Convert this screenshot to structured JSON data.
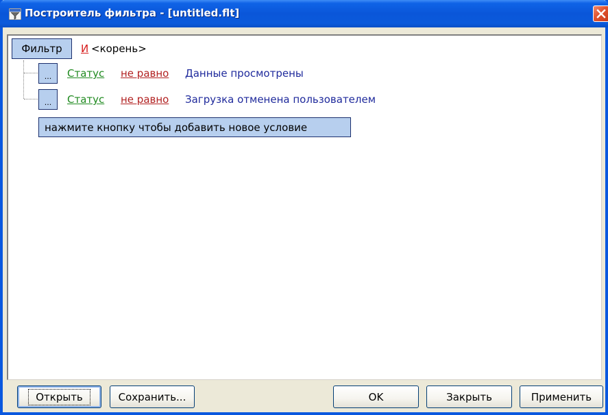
{
  "window": {
    "title": "Построитель фильтра - [untitled.flt]",
    "icon": "filter-funnel-icon",
    "close_icon": "close-icon"
  },
  "filter": {
    "button_label": "Фильтр",
    "operator": "И",
    "root_label": "<корень>",
    "conditions": [
      {
        "button_label": "...",
        "field": "Статус",
        "operator": "не равно",
        "value": "Данные просмотрены"
      },
      {
        "button_label": "...",
        "field": "Статус",
        "operator": "не равно",
        "value": "Загрузка отменена пользователем"
      }
    ],
    "add_condition_label": "нажмите кнопку чтобы добавить новое условие"
  },
  "buttons": {
    "open": "Открыть",
    "save": "Сохранить...",
    "ok": "OK",
    "close": "Закрыть",
    "apply": "Применить"
  },
  "colors": {
    "title_bar": "#0a56d9",
    "field_link": "#1f8a1f",
    "operator_link": "#b22222",
    "value_text": "#1f2a9c",
    "group_operator": "#d61a1a",
    "tree_button_bg": "#b7cfee"
  }
}
